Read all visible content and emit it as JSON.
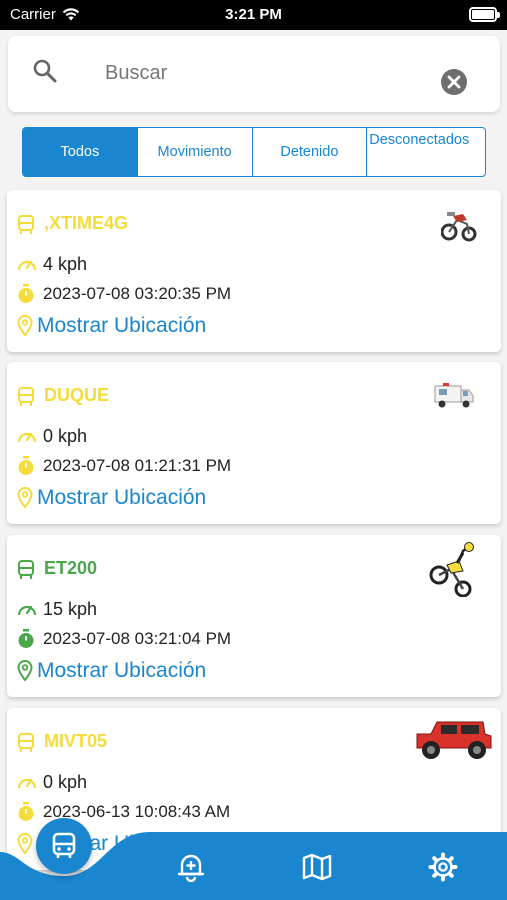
{
  "status_bar": {
    "carrier": "Carrier",
    "time": "3:21 PM"
  },
  "search": {
    "placeholder": "Buscar"
  },
  "tabs": [
    {
      "label": "Todos",
      "active": true
    },
    {
      "label": "Movimiento",
      "active": false
    },
    {
      "label": "Detenido",
      "active": false
    },
    {
      "label": "Desconectados",
      "active": false
    }
  ],
  "colors": {
    "primary": "#1a86d0",
    "idle": "#f5dc3c",
    "moving": "#4aa84a"
  },
  "vehicles": [
    {
      "name": ",XTIME4G",
      "speed": "4 kph",
      "datetime": "2023-07-08 03:20:35 PM",
      "link": "Mostrar Ubicación",
      "status_color": "#f5dc3c",
      "thumb": "dirt-bike-icon"
    },
    {
      "name": "DUQUE",
      "speed": "0 kph",
      "datetime": "2023-07-08 01:21:31 PM",
      "link": "Mostrar Ubicación",
      "status_color": "#f5dc3c",
      "thumb": "ambulance-icon"
    },
    {
      "name": "ET200",
      "speed": "15 kph",
      "datetime": "2023-07-08 03:21:04 PM",
      "link": "Mostrar Ubicación",
      "status_color": "#4aa84a",
      "thumb": "motorbike-rider-icon"
    },
    {
      "name": "MIVT05",
      "speed": "0 kph",
      "datetime": "2023-06-13 10:08:43 AM",
      "link": "Mostrar Ubicación",
      "status_color": "#f5dc3c",
      "thumb": "red-jeep-icon"
    }
  ],
  "bottom_nav": [
    {
      "name": "vehicles",
      "icon": "bus-icon",
      "active": true
    },
    {
      "name": "alerts",
      "icon": "bell-add-icon",
      "active": false
    },
    {
      "name": "map",
      "icon": "map-icon",
      "active": false
    },
    {
      "name": "settings",
      "icon": "gear-icon",
      "active": false
    }
  ]
}
